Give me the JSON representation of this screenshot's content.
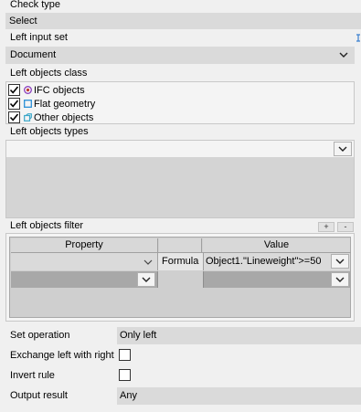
{
  "check_type": {
    "label": "Check type",
    "value": "Select"
  },
  "left_input_set": {
    "label": "Left input set",
    "value": "Document"
  },
  "left_objects_class": {
    "label": "Left objects class",
    "items": [
      {
        "label": "IFC objects",
        "checked": true,
        "icon": "ifc-icon"
      },
      {
        "label": "Flat geometry",
        "checked": true,
        "icon": "flat-geometry-icon"
      },
      {
        "label": "Other objects",
        "checked": true,
        "icon": "other-objects-icon"
      }
    ]
  },
  "left_objects_types": {
    "label": "Left objects types"
  },
  "left_objects_filter": {
    "label": "Left objects filter",
    "add_label": "+",
    "remove_label": "-",
    "columns": {
      "property": "Property",
      "value": "Value"
    },
    "rows": [
      {
        "property": "",
        "operator": "Formula",
        "value": "Object1.\"Lineweight\">=50"
      },
      {
        "property": "",
        "operator": "",
        "value": ""
      }
    ]
  },
  "set_operation": {
    "label": "Set operation",
    "value": "Only left"
  },
  "exchange": {
    "label": "Exchange left with right",
    "checked": false
  },
  "invert_rule": {
    "label": "Invert rule",
    "checked": false
  },
  "output_result": {
    "label": "Output result",
    "value": "Any"
  },
  "colors": {
    "field": "#dadada",
    "background": "#f0f0f0",
    "ifc_icon": "#8a3fbf",
    "flat_icon": "#2a8fd6",
    "other_icon": "#3aa6c8"
  }
}
